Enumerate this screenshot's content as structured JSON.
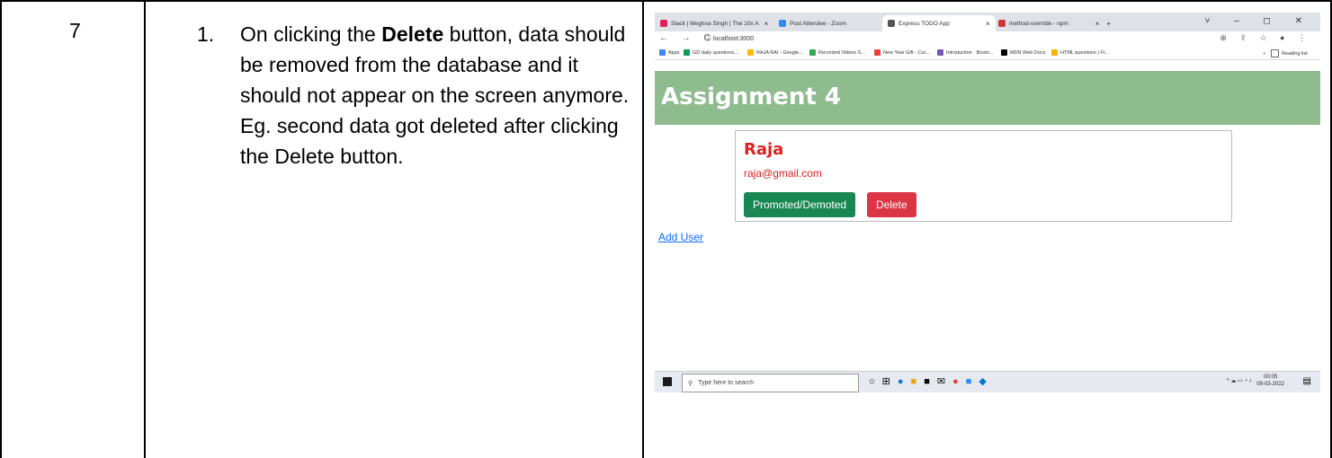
{
  "row": {
    "number": "7",
    "item_marker": "1.",
    "desc_prefix": "On clicking the ",
    "desc_bold": "Delete",
    "desc_suffix": " button, data should be removed from the database and it should not appear on the screen anymore. Eg. second data got deleted after clicking the Delete button."
  },
  "browser": {
    "tabs": [
      {
        "label": "Slack | Meghna Singh | The 10x A",
        "icon_color": "#e01e5a"
      },
      {
        "label": "Post Attendee - Zoom",
        "icon_color": "#2d8cff"
      },
      {
        "label": "Express TODO App",
        "icon_color": "#555555"
      },
      {
        "label": "method-override - npm",
        "icon_color": "#cb3837"
      }
    ],
    "url": "localhost:3000",
    "bookmarks": [
      {
        "label": "Apps",
        "color": "#4285f4"
      },
      {
        "label": "GD daily questions...",
        "color": "#0f9d58"
      },
      {
        "label": "RAJA RAI - Google...",
        "color": "#fbbc04"
      },
      {
        "label": "Recorded Videos S...",
        "color": "#34a853"
      },
      {
        "label": "New Year Gift - Cur...",
        "color": "#ea4335"
      },
      {
        "label": "Introduction · Boots...",
        "color": "#7952b3"
      },
      {
        "label": "MDN Web Docs",
        "color": "#000000"
      },
      {
        "label": "HTML questions | Fr...",
        "color": "#f4b400"
      }
    ],
    "reading_list": "Reading list"
  },
  "app": {
    "title": "Assignment 4",
    "user_name": "Raja",
    "user_email": "raja@gmail.com",
    "promote_label": "Promoted/Demoted",
    "delete_label": "Delete",
    "add_user_label": "Add User"
  },
  "taskbar": {
    "search_placeholder": "Type here to search",
    "time": "00:05",
    "date": "09-03-2022"
  }
}
